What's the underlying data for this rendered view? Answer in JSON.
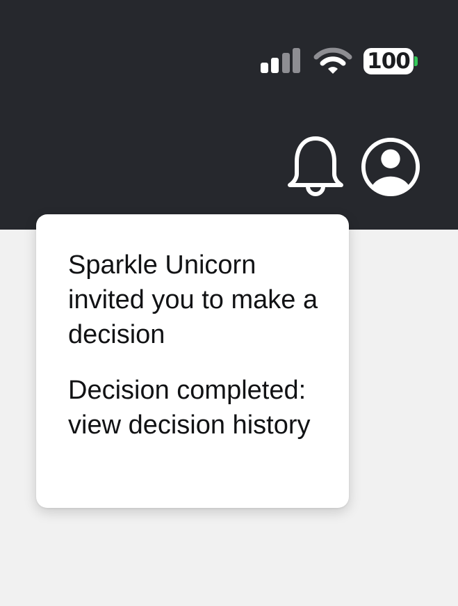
{
  "status_bar": {
    "battery_level": "100",
    "signal_strength_bars": 2,
    "signal_total_bars": 4,
    "colors": {
      "background": "#26282d",
      "icon_active": "#ffffff",
      "icon_inactive": "#8e8e93",
      "battery_charge_tip": "#34c759"
    },
    "icons": [
      "cellular-signal-icon",
      "wifi-icon",
      "battery-icon"
    ]
  },
  "header": {
    "icons": [
      "bell-icon",
      "user-account-icon"
    ]
  },
  "notifications": {
    "items": [
      {
        "text": "Sparkle Unicorn invited you to make a decision"
      },
      {
        "text": "Decision completed: view decision history"
      }
    ]
  },
  "colors": {
    "page_background": "#f1f1f1",
    "popover_background": "#ffffff",
    "text": "#111214"
  }
}
